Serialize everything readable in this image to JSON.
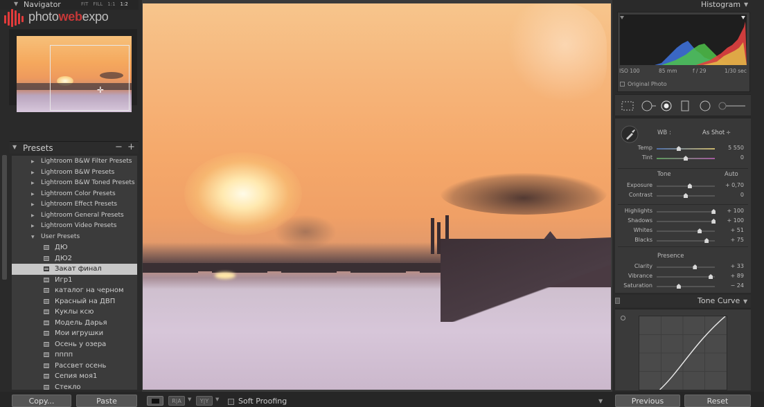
{
  "navigator": {
    "title": "Navigator",
    "zoom_options": [
      "FIT",
      "FILL",
      "1:1",
      "1:2"
    ],
    "active_zoom": "1:2"
  },
  "logo": {
    "part1": "photo",
    "part2": "web",
    "part3": "expo"
  },
  "presets": {
    "title": "Presets",
    "minus": "−",
    "plus": "+",
    "folders": [
      "Lightroom B&W Filter Presets",
      "Lightroom B&W Presets",
      "Lightroom B&W Toned Presets",
      "Lightroom Color Presets",
      "Lightroom Effect Presets",
      "Lightroom General Presets",
      "Lightroom Video Presets",
      "User Presets"
    ],
    "user_presets": [
      "ДЮ",
      "ДЮ2",
      "Закат финал",
      "Игр1",
      "каталог на черном",
      "Красный на ДВП",
      "Куклы ксю",
      "Модель Дарья",
      "Мои игрушки",
      "Осень у озера",
      "пппп",
      "Рассвет осень",
      "Сепия моя1",
      "Стекло"
    ],
    "selected": "Закат финал"
  },
  "histogram": {
    "title": "Histogram",
    "iso": "ISO 100",
    "focal": "85 mm",
    "aperture": "f / 29",
    "shutter": "1/30 sec",
    "original_photo": "Original Photo"
  },
  "tools": [
    "crop-icon",
    "spot-removal-icon",
    "red-eye-icon",
    "graduated-filter-icon",
    "radial-filter-icon",
    "adjustment-brush-icon"
  ],
  "basic": {
    "wb_label": "WB :",
    "wb_value": "As Shot",
    "wb_arrow": "÷",
    "tone_label": "Tone",
    "auto_label": "Auto",
    "presence_label": "Presence",
    "sliders": [
      {
        "label": "Temp",
        "value": "5 550",
        "pos": 0.38
      },
      {
        "label": "Tint",
        "value": "0",
        "pos": 0.5
      },
      {
        "label": "Exposure",
        "value": "+ 0,70",
        "pos": 0.57
      },
      {
        "label": "Contrast",
        "value": "0",
        "pos": 0.5
      },
      {
        "label": "Highlights",
        "value": "+ 100",
        "pos": 0.98
      },
      {
        "label": "Shadows",
        "value": "+ 100",
        "pos": 0.98
      },
      {
        "label": "Whites",
        "value": "+ 51",
        "pos": 0.74
      },
      {
        "label": "Blacks",
        "value": "+ 75",
        "pos": 0.86
      },
      {
        "label": "Clarity",
        "value": "+ 33",
        "pos": 0.66
      },
      {
        "label": "Vibrance",
        "value": "+ 89",
        "pos": 0.93
      },
      {
        "label": "Saturation",
        "value": "− 24",
        "pos": 0.38
      }
    ]
  },
  "tone_curve": {
    "title": "Tone Curve"
  },
  "bottom": {
    "copy": "Copy...",
    "paste": "Paste",
    "soft_proofing": "Soft Proofing",
    "previous": "Previous",
    "reset": "Reset",
    "ab_label": "R|A",
    "yy_label": "Y|Y"
  },
  "colors": {
    "selected_row": "#c8c8c8",
    "accent_red": "#e23b3b"
  }
}
